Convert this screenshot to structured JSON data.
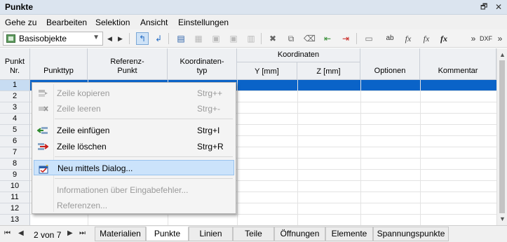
{
  "window": {
    "title": "Punkte",
    "restore_icon": "restore-icon",
    "close_icon": "close-icon"
  },
  "menu": [
    "Gehe zu",
    "Bearbeiten",
    "Selektion",
    "Ansicht",
    "Einstellungen"
  ],
  "toolbar": {
    "combo_value": "Basisobjekte",
    "more_label": "»"
  },
  "table": {
    "headers": {
      "punkt_nr": [
        "Punkt",
        "Nr."
      ],
      "punkttyp": "Punkttyp",
      "referenz": [
        "Referenz-",
        "Punkt"
      ],
      "koordinatentyp": [
        "Koordinaten-",
        "typ"
      ],
      "koordinaten": "Koordinaten",
      "y": "Y [mm]",
      "z": "Z [mm]",
      "optionen": "Optionen",
      "kommentar": "Kommentar"
    },
    "row_numbers": [
      "1",
      "2",
      "3",
      "4",
      "5",
      "6",
      "7",
      "8",
      "9",
      "10",
      "11",
      "12",
      "13"
    ],
    "selected_row": "1"
  },
  "context_menu": {
    "items": [
      {
        "label": "Zeile kopieren",
        "shortcut": "Strg++",
        "enabled": false,
        "icon": "copy-row-icon"
      },
      {
        "label": "Zeile leeren",
        "shortcut": "Strg+-",
        "enabled": false,
        "icon": "clear-row-icon"
      },
      {
        "label": "Zeile einfügen",
        "shortcut": "Strg+I",
        "enabled": true,
        "icon": "insert-row-icon"
      },
      {
        "label": "Zeile löschen",
        "shortcut": "Strg+R",
        "enabled": true,
        "icon": "delete-row-icon"
      },
      {
        "label": "Neu mittels Dialog...",
        "shortcut": "",
        "enabled": true,
        "highlighted": true,
        "icon": "new-dialog-icon"
      },
      {
        "label": "Informationen über Eingabefehler...",
        "shortcut": "",
        "enabled": false
      },
      {
        "label": "Referenzen...",
        "shortcut": "",
        "enabled": false
      }
    ]
  },
  "tabs": {
    "pager": "2 von 7",
    "items": [
      "Materialien",
      "Punkte",
      "Linien",
      "Teile",
      "Öffnungen",
      "Elemente",
      "Spannungspunkte"
    ],
    "active": "Punkte"
  },
  "colors": {
    "selection": "#0a63c8",
    "highlight": "#cbe3fb",
    "header_bg": "#eef0f3"
  }
}
